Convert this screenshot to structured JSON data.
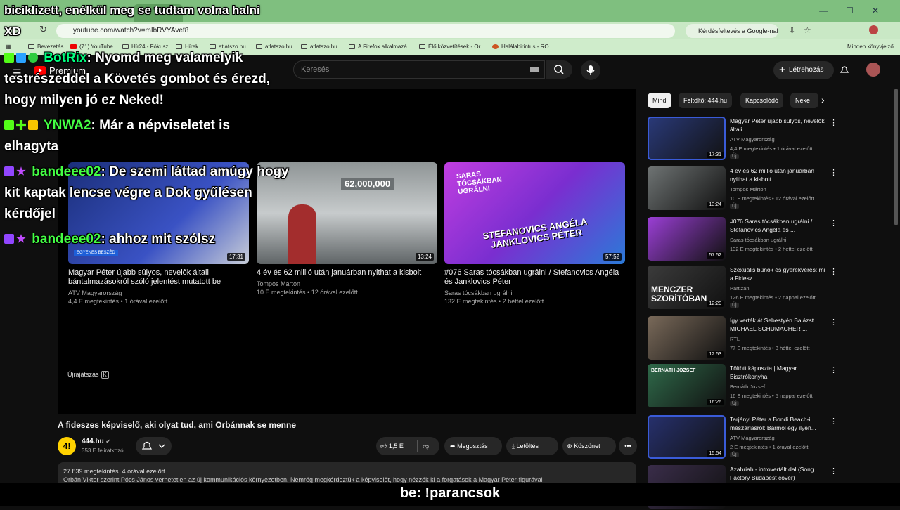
{
  "browser": {
    "url": "youtube.com/watch?v=mIbRVYAvef8",
    "google_search_chip": "Kérdésfeltevés a Google-nak",
    "right_hint": "Minden könyvjelző",
    "bookmarks": [
      "Bevezetés",
      "(71) YouTube",
      "Hír24 - Fókusz",
      "Hírek",
      "atlatszo.hu",
      "atlatszo.hu",
      "atlatszo.hu",
      "A Firefox alkalmazá...",
      "Élő közvetítések - Or...",
      "Halálabirintus - RO..."
    ]
  },
  "header": {
    "logo_text": "Premium",
    "search_placeholder": "Keresés",
    "create_label": "Létrehozás"
  },
  "player": {
    "endscreen": [
      {
        "title": "Magyar Péter újabb súlyos, nevelők általi bántalmazásokról szóló jelentést mutatott be",
        "channel": "ATV Magyarország",
        "stats": "4,4 E megtekintés • 1 órával ezelőtt",
        "duration": "17:31",
        "banner": "EGYENES BESZÉD"
      },
      {
        "title": "4 év és 62 millió után januárban nyithat a kisbolt",
        "channel": "Tompos Márton",
        "stats": "10 E megtekintés • 12 órával ezelőtt",
        "duration": "13:24",
        "overlay": "62,000,000"
      },
      {
        "title": "#076 Saras tócsákban ugrálni / Stefanovics Angéla és Janklovics Péter",
        "channel": "Saras tócsákban ugrálni",
        "stats": "132 E megtekintés • 2 héttel ezelőtt",
        "duration": "57:52",
        "overlay_top": "SARAS TÓCSÁKBAN UGRÁLNI",
        "overlay_bottom": "STEFANOVICS ANGÉLA JANKLOVICS PÉTER"
      }
    ],
    "replay_label": "Újrajátszás",
    "replay_key": "K"
  },
  "video": {
    "title": "A fideszes képviselő, aki olyat tud, ami Orbánnak se menne",
    "channel": "444.hu",
    "channel_avatar": "4!",
    "subscribers": "353 E feliratkozó",
    "likes": "1,5 E",
    "share": "Megosztás",
    "download": "Letöltés",
    "thanks": "Köszönet",
    "more": "•••",
    "views": "27 839 megtekintés",
    "age": "4 órával ezelőtt",
    "description": "Orbán Viktor szerint Pócs János verhetetlen az új kommunikációs környezetben. Nemrég megkérdeztük a képviselőt, hogy nézzék ki a forgatások a Magyar Péter-figurával"
  },
  "sidebar": {
    "chips": [
      "Mind",
      "Feltöltő: 444.hu",
      "Kapcsolódó",
      "Neke"
    ],
    "items": [
      {
        "title": "Magyar Péter újabb súlyos, nevelők általi ...",
        "channel": "ATV Magyarország",
        "stats": "4,4 E megtekintés • 1 órával ezelőtt",
        "duration": "17:31",
        "badge": "Új",
        "color": "#2a3a7a"
      },
      {
        "title": "4 év és 62 millió után januárban nyithat a kisbolt",
        "channel": "Tompos Márton",
        "stats": "10 E megtekintés • 12 órával ezelőtt",
        "duration": "13:24",
        "badge": "Új",
        "color": "#6f7474"
      },
      {
        "title": "#076 Saras tócsákban ugrálni / Stefanovics Angéla és ...",
        "channel": "Saras tócsákban ugrálni",
        "stats": "132 E megtekintés • 2 héttel ezelőtt",
        "duration": "57:52",
        "badge": "",
        "color": "#9b3fd6"
      },
      {
        "title": "Szexuális bűnök és gyerekverés: mi a Fidesz ...",
        "channel": "Partizán",
        "stats": "126 E megtekintés • 2 nappal ezelőtt",
        "duration": "12:20",
        "badge": "Új",
        "color": "#3b3b3b",
        "thumb_text": "MENCZER SZORÍTÓBAN"
      },
      {
        "title": "Így verték át Sebestyén Balázst MICHAEL SCHUMACHER ...",
        "channel": "RTL",
        "stats": "77 E megtekintés • 3 héttel ezelőtt",
        "duration": "12:53",
        "badge": "",
        "color": "#7a6a5a"
      },
      {
        "title": "Töltött káposzta | Magyar Bisztrókonyha",
        "channel": "Bernáth József",
        "stats": "16 E megtekintés • 5 nappal ezelőtt",
        "duration": "16:26",
        "badge": "Új",
        "color": "#2f6a4a",
        "thumb_text": "BERNÁTH JÓZSEF"
      },
      {
        "title": "Tarjányi Péter a Bondi Beach-i mészárlásról: Barmol egy ilyen...",
        "channel": "ATV Magyarország",
        "stats": "2 E megtekintés • 1 órával ezelőtt",
        "duration": "15:54",
        "badge": "Új",
        "color": "#27316f"
      },
      {
        "title": "Azahriah - introvertált dal (Song Factory Budapest cover)",
        "channel": "",
        "stats": "",
        "duration": "",
        "badge": "",
        "color": "#3a2d4a"
      }
    ]
  },
  "overlays": {
    "caption_top": "biciklizett, enélkül meg se tudtam volna halni",
    "caption_xd": "XD",
    "chat": [
      {
        "user": "BotRix",
        "text": ": Nyomd meg valamelyik",
        "cont": [
          "testrészeddel a Követés gombot és érezd,",
          "hogy milyen jó ez Neked!"
        ]
      },
      {
        "user": "YNWA2",
        "text": ": Már a népviseletet is",
        "cont": [
          "elhagyta"
        ]
      },
      {
        "user": "bandeee02",
        "text": ": De szemi láttad amúgy hogy",
        "cont": [
          "kit kaptak lencse végre a Dok gyűlésen",
          "kérdőjel"
        ]
      },
      {
        "user": "bandeee02",
        "text": ": ahhoz mit szólsz",
        "cont": []
      }
    ],
    "bottom_text": "be: !parancsok"
  }
}
